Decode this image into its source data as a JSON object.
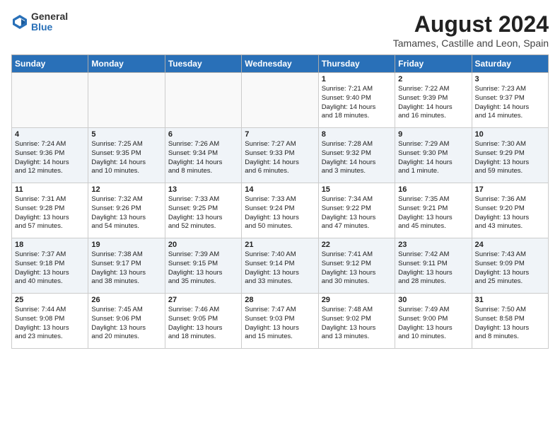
{
  "logo": {
    "general": "General",
    "blue": "Blue"
  },
  "title": "August 2024",
  "location": "Tamames, Castille and Leon, Spain",
  "weekdays": [
    "Sunday",
    "Monday",
    "Tuesday",
    "Wednesday",
    "Thursday",
    "Friday",
    "Saturday"
  ],
  "weeks": [
    [
      {
        "day": "",
        "info": ""
      },
      {
        "day": "",
        "info": ""
      },
      {
        "day": "",
        "info": ""
      },
      {
        "day": "",
        "info": ""
      },
      {
        "day": "1",
        "info": "Sunrise: 7:21 AM\nSunset: 9:40 PM\nDaylight: 14 hours\nand 18 minutes."
      },
      {
        "day": "2",
        "info": "Sunrise: 7:22 AM\nSunset: 9:39 PM\nDaylight: 14 hours\nand 16 minutes."
      },
      {
        "day": "3",
        "info": "Sunrise: 7:23 AM\nSunset: 9:37 PM\nDaylight: 14 hours\nand 14 minutes."
      }
    ],
    [
      {
        "day": "4",
        "info": "Sunrise: 7:24 AM\nSunset: 9:36 PM\nDaylight: 14 hours\nand 12 minutes."
      },
      {
        "day": "5",
        "info": "Sunrise: 7:25 AM\nSunset: 9:35 PM\nDaylight: 14 hours\nand 10 minutes."
      },
      {
        "day": "6",
        "info": "Sunrise: 7:26 AM\nSunset: 9:34 PM\nDaylight: 14 hours\nand 8 minutes."
      },
      {
        "day": "7",
        "info": "Sunrise: 7:27 AM\nSunset: 9:33 PM\nDaylight: 14 hours\nand 6 minutes."
      },
      {
        "day": "8",
        "info": "Sunrise: 7:28 AM\nSunset: 9:32 PM\nDaylight: 14 hours\nand 3 minutes."
      },
      {
        "day": "9",
        "info": "Sunrise: 7:29 AM\nSunset: 9:30 PM\nDaylight: 14 hours\nand 1 minute."
      },
      {
        "day": "10",
        "info": "Sunrise: 7:30 AM\nSunset: 9:29 PM\nDaylight: 13 hours\nand 59 minutes."
      }
    ],
    [
      {
        "day": "11",
        "info": "Sunrise: 7:31 AM\nSunset: 9:28 PM\nDaylight: 13 hours\nand 57 minutes."
      },
      {
        "day": "12",
        "info": "Sunrise: 7:32 AM\nSunset: 9:26 PM\nDaylight: 13 hours\nand 54 minutes."
      },
      {
        "day": "13",
        "info": "Sunrise: 7:33 AM\nSunset: 9:25 PM\nDaylight: 13 hours\nand 52 minutes."
      },
      {
        "day": "14",
        "info": "Sunrise: 7:33 AM\nSunset: 9:24 PM\nDaylight: 13 hours\nand 50 minutes."
      },
      {
        "day": "15",
        "info": "Sunrise: 7:34 AM\nSunset: 9:22 PM\nDaylight: 13 hours\nand 47 minutes."
      },
      {
        "day": "16",
        "info": "Sunrise: 7:35 AM\nSunset: 9:21 PM\nDaylight: 13 hours\nand 45 minutes."
      },
      {
        "day": "17",
        "info": "Sunrise: 7:36 AM\nSunset: 9:20 PM\nDaylight: 13 hours\nand 43 minutes."
      }
    ],
    [
      {
        "day": "18",
        "info": "Sunrise: 7:37 AM\nSunset: 9:18 PM\nDaylight: 13 hours\nand 40 minutes."
      },
      {
        "day": "19",
        "info": "Sunrise: 7:38 AM\nSunset: 9:17 PM\nDaylight: 13 hours\nand 38 minutes."
      },
      {
        "day": "20",
        "info": "Sunrise: 7:39 AM\nSunset: 9:15 PM\nDaylight: 13 hours\nand 35 minutes."
      },
      {
        "day": "21",
        "info": "Sunrise: 7:40 AM\nSunset: 9:14 PM\nDaylight: 13 hours\nand 33 minutes."
      },
      {
        "day": "22",
        "info": "Sunrise: 7:41 AM\nSunset: 9:12 PM\nDaylight: 13 hours\nand 30 minutes."
      },
      {
        "day": "23",
        "info": "Sunrise: 7:42 AM\nSunset: 9:11 PM\nDaylight: 13 hours\nand 28 minutes."
      },
      {
        "day": "24",
        "info": "Sunrise: 7:43 AM\nSunset: 9:09 PM\nDaylight: 13 hours\nand 25 minutes."
      }
    ],
    [
      {
        "day": "25",
        "info": "Sunrise: 7:44 AM\nSunset: 9:08 PM\nDaylight: 13 hours\nand 23 minutes."
      },
      {
        "day": "26",
        "info": "Sunrise: 7:45 AM\nSunset: 9:06 PM\nDaylight: 13 hours\nand 20 minutes."
      },
      {
        "day": "27",
        "info": "Sunrise: 7:46 AM\nSunset: 9:05 PM\nDaylight: 13 hours\nand 18 minutes."
      },
      {
        "day": "28",
        "info": "Sunrise: 7:47 AM\nSunset: 9:03 PM\nDaylight: 13 hours\nand 15 minutes."
      },
      {
        "day": "29",
        "info": "Sunrise: 7:48 AM\nSunset: 9:02 PM\nDaylight: 13 hours\nand 13 minutes."
      },
      {
        "day": "30",
        "info": "Sunrise: 7:49 AM\nSunset: 9:00 PM\nDaylight: 13 hours\nand 10 minutes."
      },
      {
        "day": "31",
        "info": "Sunrise: 7:50 AM\nSunset: 8:58 PM\nDaylight: 13 hours\nand 8 minutes."
      }
    ]
  ]
}
